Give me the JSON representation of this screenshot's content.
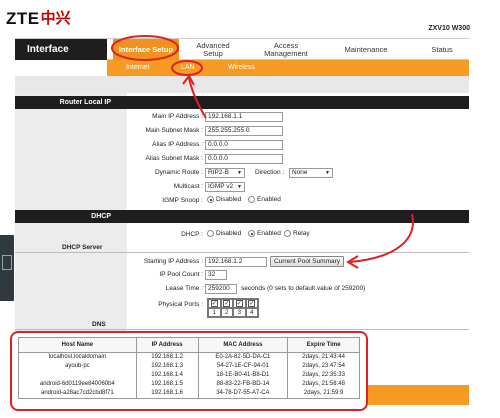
{
  "brand": {
    "logo_latin": "ZTE",
    "logo_cn": "中兴",
    "model": "ZXV10 W300"
  },
  "nav": {
    "section": "Interface",
    "tabs": [
      {
        "label": "Interface Setup",
        "active": true
      },
      {
        "label": "Advanced Setup",
        "active": false
      },
      {
        "label": "Access Management",
        "active": false
      },
      {
        "label": "Maintenance",
        "active": false
      },
      {
        "label": "Status",
        "active": false
      }
    ],
    "subtabs": [
      "Internet",
      "LAN",
      "Wireless"
    ]
  },
  "router_local_ip": {
    "header": "Router Local IP",
    "main_ip_label": "Main IP Address :",
    "main_ip": "192.168.1.1",
    "main_mask_label": "Main Subnet Mask :",
    "main_mask": "255.255.255.0",
    "alias_ip_label": "Alias IP Address :",
    "alias_ip": "0.0.0.0",
    "alias_mask_label": "Alias Subnet Mask :",
    "alias_mask": "0.0.0.0",
    "dynamic_route_label": "Dynamic Route :",
    "dynamic_route": "RIP2-B",
    "direction_label": "Direction :",
    "direction": "None",
    "multicast_label": "Multicast :",
    "multicast": "IGMP v2",
    "igmp_snoop_label": "IGMP Snoop :",
    "igmp_disabled": "Disabled",
    "igmp_enabled": "Enabled"
  },
  "dhcp": {
    "header": "DHCP",
    "label": "DHCP :",
    "opt_disabled": "Disabled",
    "opt_enabled": "Enabled",
    "opt_relay": "Relay"
  },
  "dhcp_server": {
    "header": "DHCP Server",
    "start_ip_label": "Starting IP Address :",
    "start_ip": "192.168.1.2",
    "summary_button": "Current Pool Summary",
    "pool_count_label": "IP Pool Count :",
    "pool_count": "32",
    "lease_label": "Lease Time :",
    "lease": "259200",
    "lease_note": "seconds    (0 sets to default value of 259200)",
    "ports_label": "Physical Ports :",
    "ports": [
      "1",
      "2",
      "3",
      "4"
    ],
    "ports_checked": true
  },
  "dns": {
    "header": "DNS"
  },
  "lease_table": {
    "columns": [
      "Host Name",
      "IP Address",
      "MAC Address",
      "Expire Time"
    ],
    "rows": [
      [
        "localhost.localdomain",
        "192.168.1.2",
        "E0-2A-82-5D-DA-C1",
        "2days,  21:43:44"
      ],
      [
        "ayoub-pc",
        "192.168.1.3",
        "54-27-1E-CF-94-01",
        "2days,  23:47:54"
      ],
      [
        "",
        "192.168.1.4",
        "18-1E-B0-41-B8-D1",
        "2days,  22:35:33"
      ],
      [
        "android-6d0119ee840060b4",
        "192.168.1.5",
        "88-83-22-FB-BD-14",
        "2days,  21:58:48"
      ],
      [
        "android-a28ac7cd2cbd8f71",
        "192.168.1.6",
        "34-78-D7-55-A7-CA",
        "2days,  21:59:9"
      ]
    ]
  },
  "colors": {
    "accent": "#f59a23",
    "annotation": "#dd2222",
    "header_dark": "#1e1e1e"
  }
}
